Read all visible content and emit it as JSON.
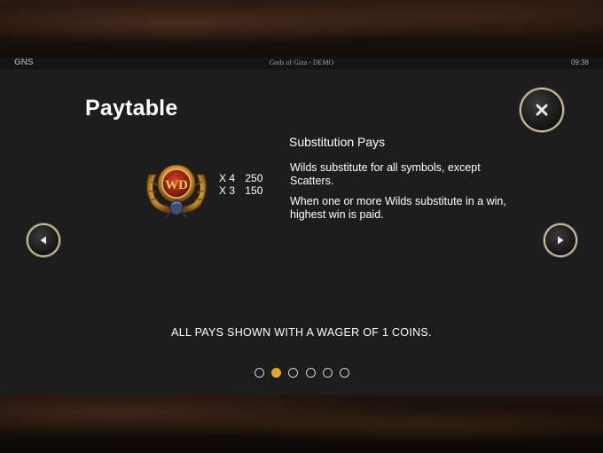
{
  "statusbar": {
    "brand": "GNS",
    "title": "Gods of Giza - DEMO",
    "time": "09:38"
  },
  "paytable": {
    "title": "Paytable",
    "symbol": {
      "icon": "wild-scarab-symbol",
      "emblem_text": "WD",
      "pays": [
        {
          "count": "X 4",
          "value": "250"
        },
        {
          "count": "X 3",
          "value": "150"
        }
      ]
    },
    "substitution": {
      "heading": "Substitution Pays",
      "paragraphs": [
        "Wilds substitute for all symbols, except Scatters.",
        "When one or more Wilds substitute in a win, highest win is paid."
      ]
    },
    "wager_note": "ALL PAYS SHOWN WITH A WAGER OF 1 COINS."
  },
  "pagination": {
    "total": 6,
    "active_index": 1
  },
  "controls": {
    "close_icon": "close-icon",
    "prev_icon": "arrow-left-icon",
    "next_icon": "arrow-right-icon"
  },
  "colors": {
    "accent": "#e0a628",
    "panel": "#1d1d1d",
    "button_ring": "#c8bf9c"
  }
}
